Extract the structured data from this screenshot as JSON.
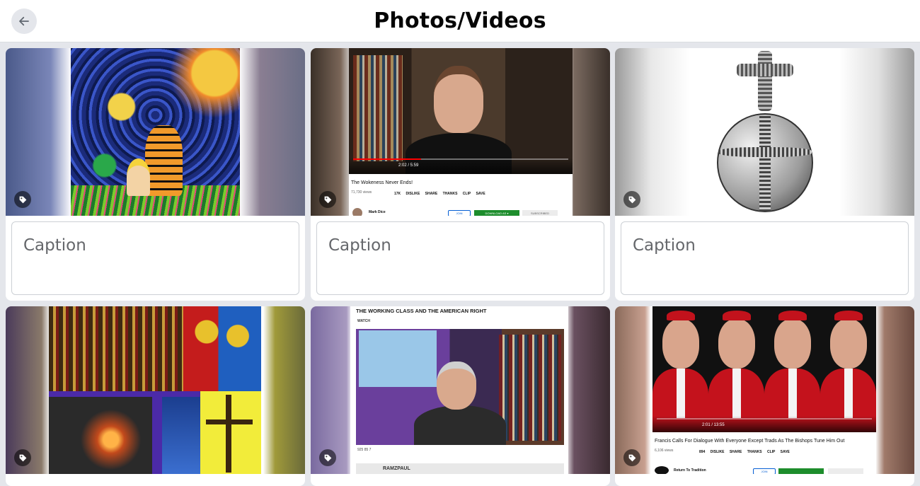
{
  "header": {
    "title": "Photos/Videos",
    "back_icon": "arrow-left-icon"
  },
  "caption_placeholder": "Caption",
  "tag_icon": "tag-icon",
  "cards": [
    {
      "image": "starry-night-calvin-hobbes-painting"
    },
    {
      "image": "youtube-video-screenshot",
      "video_title": "The Wokeness Never Ends!",
      "views": "71,730 views",
      "time": "2:02 / 5:59",
      "actions": "17K DISLIKE SHARE THANKS CLIP SAVE",
      "channel": "Mark Dice",
      "join_label": "JOIN",
      "download_label": "DOWNLOAD AS ▾",
      "subscribed_label": "SUBSCRIBED"
    },
    {
      "image": "globus-cruciger-engraving"
    },
    {
      "image": "religious-art-collage"
    },
    {
      "image": "ramzpaul-video-screenshot",
      "header_text": "THE WORKING CLASS AND THE AMERICAN RIGHT",
      "watch_label": "WATCH",
      "stats": "925   85   7",
      "channel": "RAMZPAUL"
    },
    {
      "image": "cardinals-youtube-screenshot",
      "video_title": "Francis Calls For Dialogue With Everyone Except Trads As The Bishops Tune Him Out",
      "views": "6,106 views",
      "time": "2:01 / 13:55",
      "actions": "894 DISLIKE SHARE THANKS CLIP SAVE",
      "channel": "Return To Tradition",
      "join_label": "JOIN"
    }
  ]
}
